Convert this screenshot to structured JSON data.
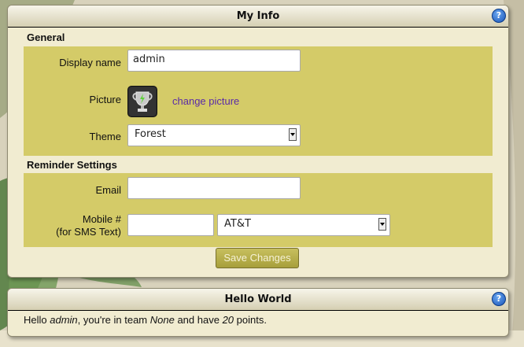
{
  "my_info": {
    "title": "My Info",
    "help_icon": "question-circle-icon",
    "general": {
      "title": "General",
      "display_name_label": "Display name",
      "display_name_value": "admin",
      "picture_label": "Picture",
      "picture_icon": "trophy-icon",
      "change_picture_link": "change picture",
      "theme_label": "Theme",
      "theme_value": "Forest"
    },
    "reminders": {
      "title": "Reminder Settings",
      "email_label": "Email",
      "email_value": "",
      "mobile_label_line1": "Mobile #",
      "mobile_label_line2": "(for SMS Text)",
      "mobile_value": "",
      "carrier_value": "AT&T"
    },
    "save_button": "Save Changes"
  },
  "hello_world": {
    "title": "Hello World",
    "help_icon": "question-circle-icon",
    "text_hello": "Hello ",
    "user": "admin",
    "text_team": ", you're in team ",
    "team": "None",
    "text_have": " and have ",
    "points": "20",
    "text_points": " points."
  },
  "colors": {
    "olive": "#d4cb68",
    "panel": "#f1ecd1",
    "link": "#5a2aa8",
    "button": "#b7af4c"
  }
}
